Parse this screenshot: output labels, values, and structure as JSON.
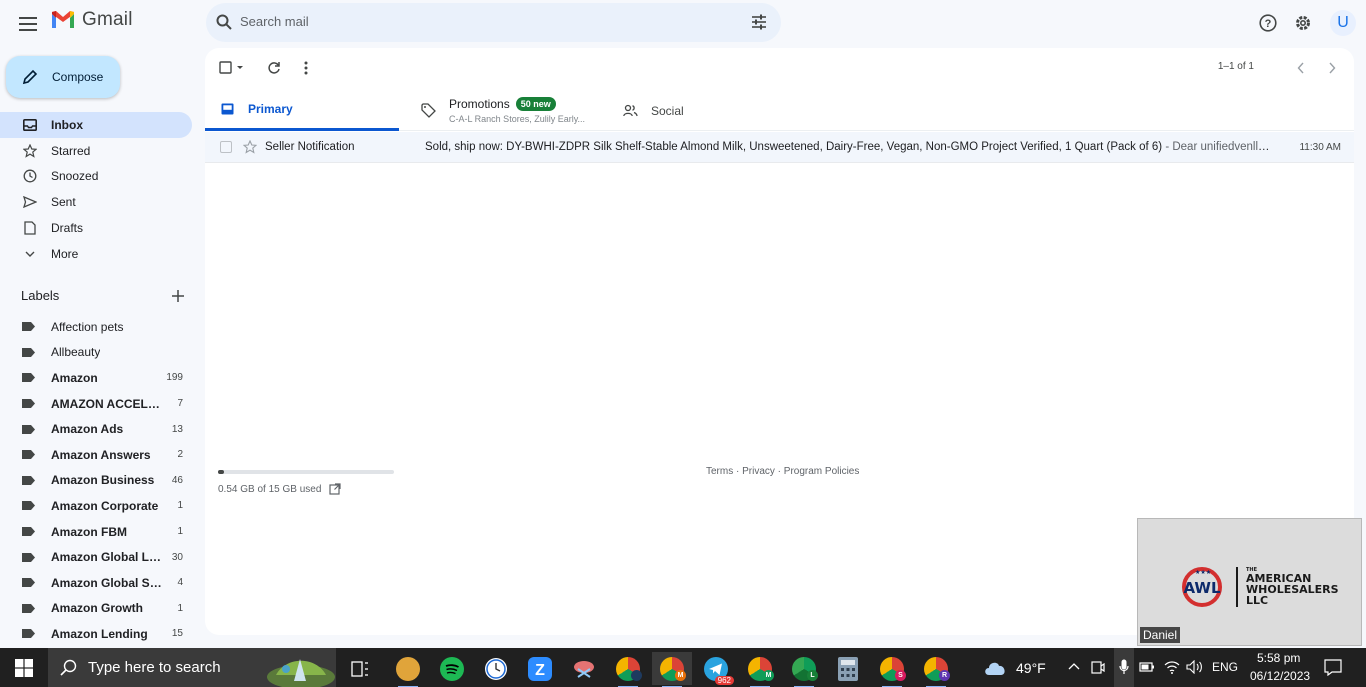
{
  "header": {
    "brand": "Gmail",
    "search_placeholder": "Search mail",
    "avatar_letter": "U"
  },
  "sidebar": {
    "compose_label": "Compose",
    "nav": [
      {
        "label": "Inbox",
        "icon": "inbox-icon",
        "active": true
      },
      {
        "label": "Starred",
        "icon": "star-icon"
      },
      {
        "label": "Snoozed",
        "icon": "clock-icon"
      },
      {
        "label": "Sent",
        "icon": "send-icon"
      },
      {
        "label": "Drafts",
        "icon": "draft-icon"
      },
      {
        "label": "More",
        "icon": "chevron-down-icon"
      }
    ],
    "labels_title": "Labels",
    "labels": [
      {
        "name": "Affection pets",
        "count": "",
        "bold": false
      },
      {
        "name": "Allbeauty",
        "count": "",
        "bold": false
      },
      {
        "name": "Amazon",
        "count": "199",
        "bold": true
      },
      {
        "name": "AMAZON ACCELER...",
        "count": "7",
        "bold": true
      },
      {
        "name": "Amazon Ads",
        "count": "13",
        "bold": true
      },
      {
        "name": "Amazon Answers",
        "count": "2",
        "bold": true
      },
      {
        "name": "Amazon Business",
        "count": "46",
        "bold": true
      },
      {
        "name": "Amazon Corporate",
        "count": "1",
        "bold": true
      },
      {
        "name": "Amazon FBM",
        "count": "1",
        "bold": true
      },
      {
        "name": "Amazon Global Lo...",
        "count": "30",
        "bold": true
      },
      {
        "name": "Amazon Global Sell...",
        "count": "4",
        "bold": true
      },
      {
        "name": "Amazon Growth",
        "count": "1",
        "bold": true
      },
      {
        "name": "Amazon Lending",
        "count": "15",
        "bold": true
      }
    ]
  },
  "toolbar": {
    "pager": "1–1 of 1"
  },
  "tabs": {
    "primary": "Primary",
    "promotions": "Promotions",
    "promotions_badge": "50 new",
    "promotions_sub": "C-A-L Ranch Stores, Zulily Early...",
    "social": "Social"
  },
  "email": {
    "sender": "Seller Notification",
    "subject": "Sold, ship now: DY-BWHI-ZDPR Silk Shelf-Stable Almond Milk, Unsweetened, Dairy-Free, Vegan, Non-GMO Project Verified, 1 Quart (Pack of 6)",
    "snippet": " - Dear unifiedvenllc@...",
    "time": "11:30 AM"
  },
  "storage": {
    "text": "0.54 GB of 15 GB used",
    "fraction": 0.036
  },
  "footer": {
    "links": "Terms · Privacy · Program Policies"
  },
  "video": {
    "logo_the": "THE",
    "logo_line1": "AMERICAN",
    "logo_line2": "WHOLESALERS",
    "logo_line3": "LLC",
    "name": "Daniel"
  },
  "taskbar": {
    "search_placeholder": "Type here to search",
    "weather": "49°F",
    "lang": "ENG",
    "time": "5:58 pm",
    "date": "06/12/2023",
    "telegram_badge": "962"
  },
  "colors": {
    "accent": "#0b57d0",
    "compose_bg": "#c2e7ff",
    "active_nav_bg": "#d3e3fd",
    "badge_green": "#188038"
  }
}
